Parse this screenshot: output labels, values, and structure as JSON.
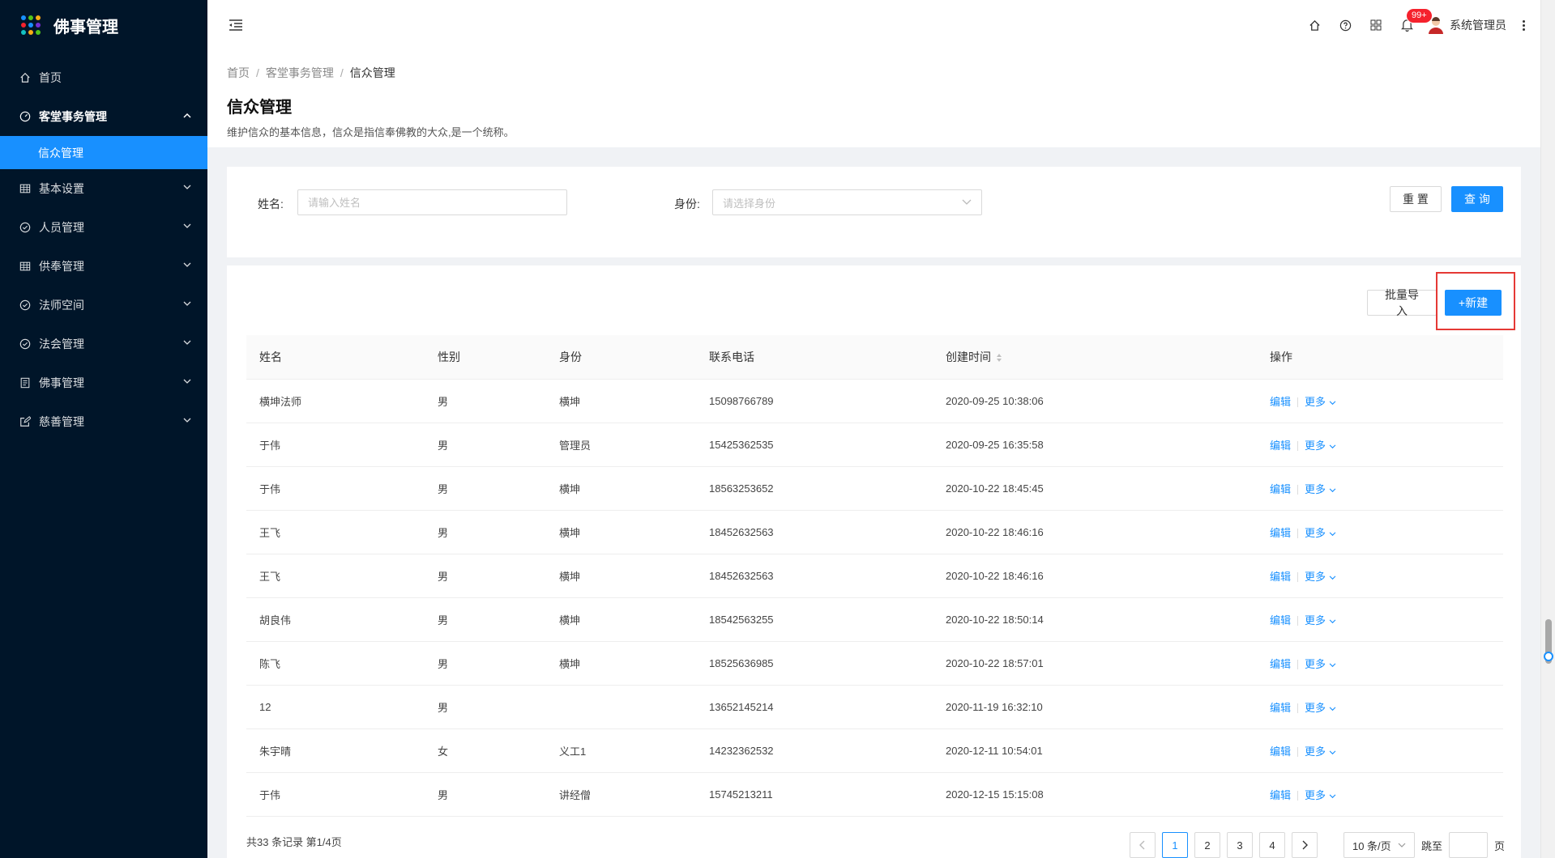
{
  "app": {
    "title": "佛事管理",
    "logo_colors": [
      "#1890ff",
      "#52c41a",
      "#faad14",
      "#f5222d",
      "#1890ff",
      "#722ed1",
      "#13c2c2",
      "#faad14",
      "#52c41a"
    ]
  },
  "sidebar": {
    "items": [
      {
        "label": "首页",
        "icon": "home-icon"
      },
      {
        "label": "客堂事务管理",
        "icon": "dashboard-icon",
        "expanded": true
      },
      {
        "label": "信众管理",
        "selected": true
      },
      {
        "label": "基本设置",
        "icon": "table-icon"
      },
      {
        "label": "人员管理",
        "icon": "check-circle-icon"
      },
      {
        "label": "供奉管理",
        "icon": "table-icon"
      },
      {
        "label": "法师空间",
        "icon": "check-circle-icon"
      },
      {
        "label": "法会管理",
        "icon": "check-circle-icon"
      },
      {
        "label": "佛事管理",
        "icon": "profile-icon"
      },
      {
        "label": "慈善管理",
        "icon": "form-icon"
      }
    ]
  },
  "header": {
    "notification_count": "99+",
    "user_name": "系统管理员"
  },
  "breadcrumb": [
    "首页",
    "客堂事务管理",
    "信众管理"
  ],
  "page": {
    "title": "信众管理",
    "description": "维护信众的基本信息，信众是指信奉佛教的大众,是一个统称。"
  },
  "search": {
    "name_label": "姓名:",
    "name_placeholder": "请输入姓名",
    "identity_label": "身份:",
    "identity_placeholder": "请选择身份",
    "reset_label": "重 置",
    "query_label": "查 询"
  },
  "toolbar": {
    "import_label": "批量导入",
    "new_label": "+新建"
  },
  "table": {
    "columns": [
      "姓名",
      "性别",
      "身份",
      "联系电话",
      "创建时间",
      "操作"
    ],
    "edit_label": "编辑",
    "more_label": "更多",
    "rows": [
      {
        "name": "横坤法师",
        "gender": "男",
        "identity": "横坤",
        "phone": "15098766789",
        "created": "2020-09-25 10:38:06"
      },
      {
        "name": "于伟",
        "gender": "男",
        "identity": "管理员",
        "phone": "15425362535",
        "created": "2020-09-25 16:35:58"
      },
      {
        "name": "于伟",
        "gender": "男",
        "identity": "横坤",
        "phone": "18563253652",
        "created": "2020-10-22 18:45:45"
      },
      {
        "name": "王飞",
        "gender": "男",
        "identity": "横坤",
        "phone": "18452632563",
        "created": "2020-10-22 18:46:16"
      },
      {
        "name": "王飞",
        "gender": "男",
        "identity": "横坤",
        "phone": "18452632563",
        "created": "2020-10-22 18:46:16"
      },
      {
        "name": "胡良伟",
        "gender": "男",
        "identity": "横坤",
        "phone": "18542563255",
        "created": "2020-10-22 18:50:14"
      },
      {
        "name": "陈飞",
        "gender": "男",
        "identity": "横坤",
        "phone": "18525636985",
        "created": "2020-10-22 18:57:01"
      },
      {
        "name": "12",
        "gender": "男",
        "identity": "",
        "phone": "13652145214",
        "created": "2020-11-19 16:32:10"
      },
      {
        "name": "朱宇晴",
        "gender": "女",
        "identity": "义工1",
        "phone": "14232362532",
        "created": "2020-12-11 10:54:01"
      },
      {
        "name": "于伟",
        "gender": "男",
        "identity": "讲经僧",
        "phone": "15745213211",
        "created": "2020-12-15 15:15:08"
      }
    ]
  },
  "pagination": {
    "summary": "共33 条记录 第1/4页",
    "pages": [
      "1",
      "2",
      "3",
      "4"
    ],
    "current": "1",
    "page_size": "10 条/页",
    "jump_label": "跳至",
    "page_suffix": "页"
  },
  "colors": {
    "primary": "#1890ff",
    "sidebar_bg": "#001529",
    "highlight": "#e53935"
  }
}
